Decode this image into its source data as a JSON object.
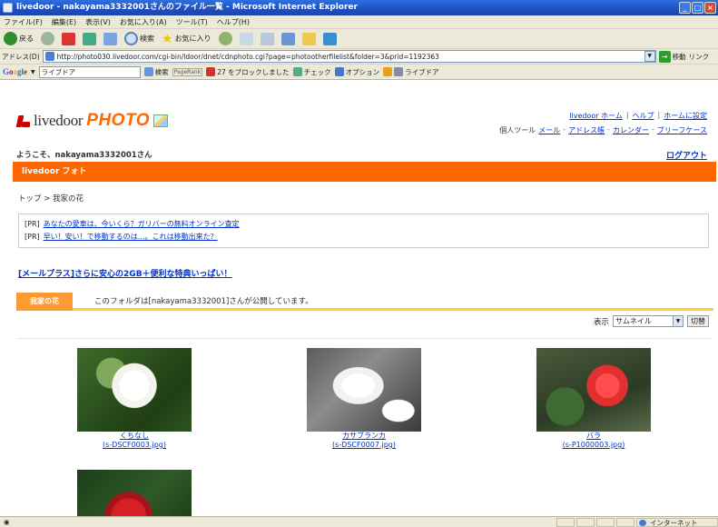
{
  "window": {
    "title": "livedoor - nakayama3332001さんのファイル一覧 - Microsoft Internet Explorer",
    "controls": [
      "_",
      "□",
      "×"
    ]
  },
  "menu": [
    "ファイル(F)",
    "編集(E)",
    "表示(V)",
    "お気に入り(A)",
    "ツール(T)",
    "ヘルプ(H)"
  ],
  "toolbar": {
    "back": "戻る",
    "search": "検索",
    "favorites": "お気に入り"
  },
  "address": {
    "label": "アドレス(D)",
    "url": "http://photo030.livedoor.com/cgi-bin/ldoor/dnet/cdnphoto.cgi?page=photootherfilelist&folder=3&prid=1192363",
    "go": "移動",
    "links": "リンク"
  },
  "googlebar": {
    "logo": [
      "G",
      "o",
      "o",
      "g",
      "l",
      "e"
    ],
    "search_value": "ライブドア",
    "search_button": "検索",
    "pagerank": "PageRank",
    "blocked": "27 をブロックしました",
    "check": "チェック",
    "options": "オプション",
    "bookmark": "ライブドア"
  },
  "site": {
    "logo_livedoor": "livedoor",
    "logo_photo": "PHOTO",
    "toplinks": [
      "livedoor ホーム",
      "ヘルプ",
      "ホームに設定"
    ],
    "tools_label": "個人ツール",
    "tools": [
      "メール",
      "アドレス帳",
      "カレンダー",
      "ブリーフケース"
    ],
    "welcome": "ようこそ、nakayama3332001さん",
    "logout": "ログアウト",
    "section_title": "livedoor フォト",
    "breadcrumb": "トップ > 我家の花",
    "pr": [
      {
        "tag": "[PR]",
        "text": "あなたの愛車は、今いくら？ガリバーの無料オンライン査定"
      },
      {
        "tag": "[PR]",
        "text": "早い！安い！で移動するのは…。これは移動出来た？"
      }
    ],
    "promo": "[メールプラス]さらに安心の2GB＋便利な特典いっぱい！",
    "folder_tab": "我家の花",
    "folder_desc": "このフォルダは[nakayama3332001]さんが公開しています。",
    "view_label": "表示",
    "view_select": "サムネイル",
    "view_button": "切替"
  },
  "gallery": [
    {
      "title": "くちなし",
      "file": "(s-DSCF0003.jpg)"
    },
    {
      "title": "カサブランカ",
      "file": "(s-DSCF0007.jpg)"
    },
    {
      "title": "バラ",
      "file": "(s-P1000003.jpg)"
    },
    {
      "title": "",
      "file": ""
    }
  ],
  "status": {
    "zone": "インターネット"
  }
}
